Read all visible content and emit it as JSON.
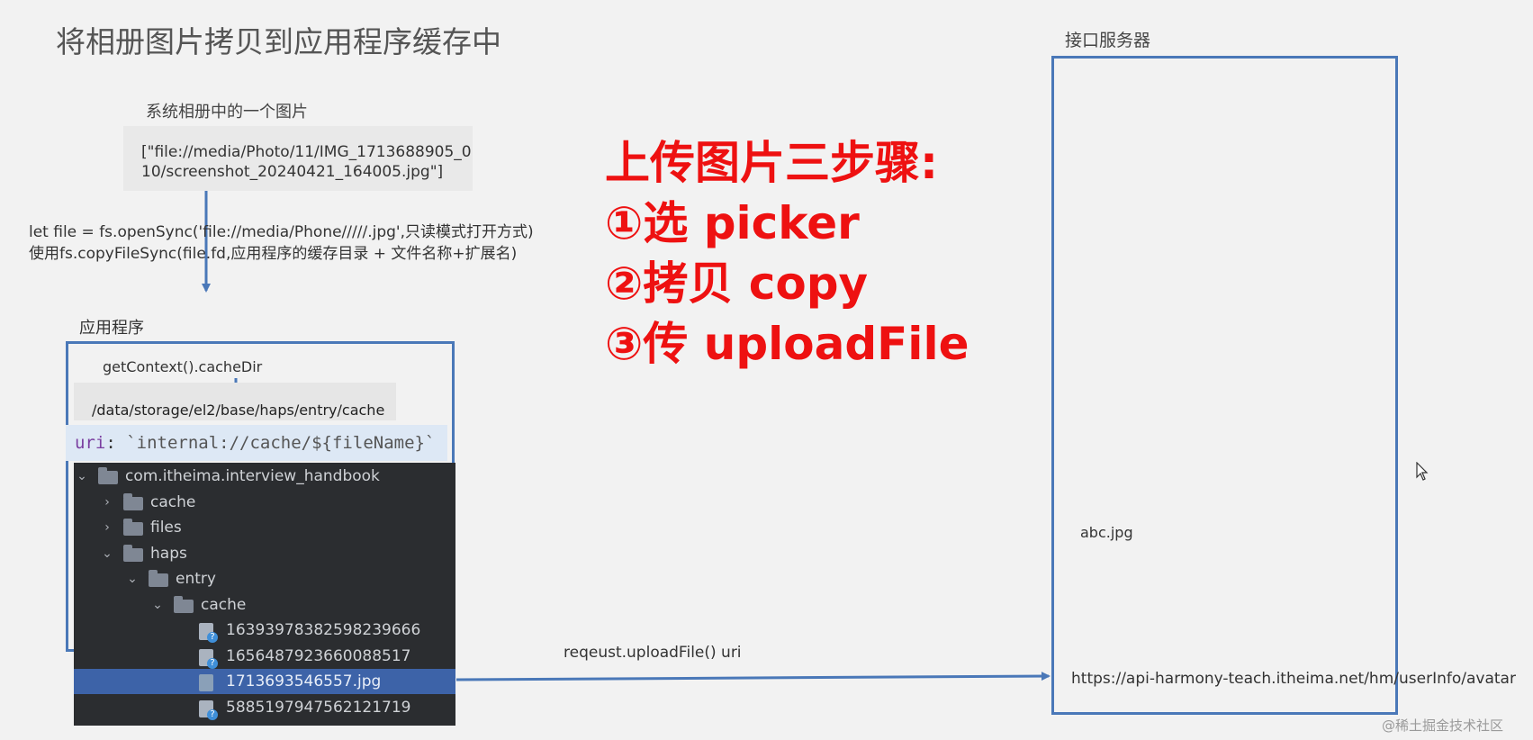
{
  "title": "将相册图片拷贝到应用程序缓存中",
  "server": {
    "label": "接口服务器",
    "file": "abc.jpg",
    "url": "https://api-harmony-teach.itheima.net/hm/userInfo/avatar"
  },
  "photo": {
    "label": "系统相册中的一个图片",
    "lines": [
      "[\"file://media/Photo/11/IMG_1713688905_0",
      "10/screenshot_20240421_164005.jpg\"]"
    ]
  },
  "code_note": {
    "lines": [
      "let file = fs.openSync('file://media/Phone/////.jpg',只读模式打开方式)",
      "使用fs.copyFileSync(file.fd,应用程序的缓存目录 + 文件名称+扩展名)"
    ]
  },
  "app": {
    "label": "应用程序",
    "cache_dir_label": "getContext().cacheDir",
    "cache_path": "/data/storage/el2/base/haps/entry/cache",
    "uri_key": "uri",
    "uri_colon": ": ",
    "uri_value": "`internal://cache/${fileName}`"
  },
  "file_tree": [
    {
      "name": "com.itheima.interview_handbook",
      "kind": "folder",
      "chevron": "open",
      "depth": 0
    },
    {
      "name": "cache",
      "kind": "folder",
      "chevron": "closed",
      "depth": 1
    },
    {
      "name": "files",
      "kind": "folder",
      "chevron": "closed",
      "depth": 1
    },
    {
      "name": "haps",
      "kind": "folder",
      "chevron": "open",
      "depth": 1
    },
    {
      "name": "entry",
      "kind": "folder",
      "chevron": "open",
      "depth": 2
    },
    {
      "name": "cache",
      "kind": "folder",
      "chevron": "open",
      "depth": 3
    },
    {
      "name": "16393978382598239666",
      "kind": "file",
      "chevron": "none",
      "depth": 4
    },
    {
      "name": "1656487923660088517",
      "kind": "file",
      "chevron": "none",
      "depth": 4
    },
    {
      "name": "1713693546557.jpg",
      "kind": "image",
      "chevron": "none",
      "depth": 4,
      "selected": true
    },
    {
      "name": "5885197947562121719",
      "kind": "file",
      "chevron": "none",
      "depth": 4
    }
  ],
  "steps": {
    "heading": "上传图片三步骤:",
    "items": [
      "①选 picker",
      "②拷贝 copy",
      "③传 uploadFile"
    ]
  },
  "upload_label": "reqeust.uploadFile() uri",
  "watermark": "@稀土掘金技术社区",
  "colors": {
    "accent_blue": "#4a78b8",
    "steps_red": "#ee1111",
    "tree_bg": "#2b2d30",
    "tree_selected": "#3d63a8"
  },
  "icons": [
    "arrow-down-icon",
    "arrow-right-icon",
    "folder-icon",
    "file-icon",
    "chevron-icon",
    "cursor-icon"
  ]
}
